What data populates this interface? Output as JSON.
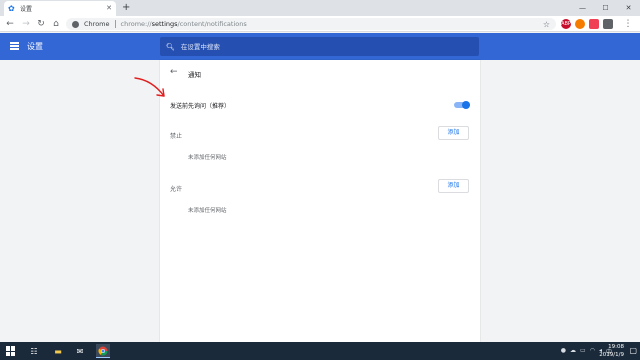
{
  "tab": {
    "title": "设置",
    "favicon": "settings-gear-icon"
  },
  "toolbar": {
    "site_label": "Chrome",
    "url_prefix": "chrome://",
    "url_host": "settings",
    "url_path": "/content/notifications",
    "extensions": [
      {
        "name": "adblock-extension-icon",
        "label": "ABP",
        "color": "#c70d2c"
      },
      {
        "name": "orange-extension-icon",
        "label": "",
        "color": "#f57c00"
      },
      {
        "name": "pocket-extension-icon",
        "label": "",
        "color": "#ef4056"
      },
      {
        "name": "shield-extension-icon",
        "label": "",
        "color": "#5f6368"
      }
    ]
  },
  "header": {
    "title": "设置",
    "search_placeholder": "在设置中搜索"
  },
  "page": {
    "back": "←",
    "title": "通知",
    "ask_label": "发送前先询问（推荐）",
    "ask_enabled": true,
    "block": {
      "label": "禁止",
      "add": "添加",
      "empty": "未添加任何网站"
    },
    "allow": {
      "label": "允许",
      "add": "添加",
      "empty": "未添加任何网站"
    }
  },
  "colors": {
    "accent": "#3367d6",
    "link": "#1a73e8",
    "annotation": "#e02020"
  },
  "taskbar": {
    "time": "19:08",
    "date": "2019/1/9",
    "ime": "中",
    "apps": [
      "task-view-icon",
      "file-explorer-icon",
      "mail-icon",
      "chrome-icon"
    ]
  }
}
